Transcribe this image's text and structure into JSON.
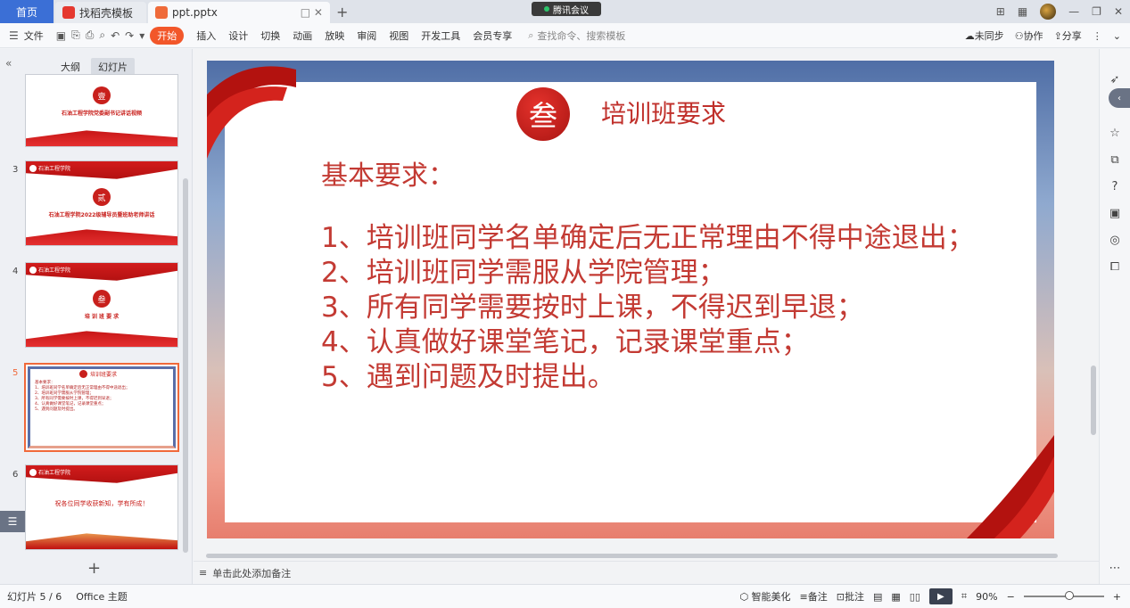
{
  "tabs": {
    "home": "首页",
    "items": [
      {
        "label": "找稻壳模板"
      },
      {
        "label": "ppt.pptx"
      }
    ],
    "add": "+",
    "meeting": "腾讯会议"
  },
  "menu": {
    "file": "文件",
    "items": [
      "开始",
      "插入",
      "设计",
      "切换",
      "动画",
      "放映",
      "审阅",
      "视图",
      "开发工具",
      "会员专享"
    ],
    "search_placeholder": "查找命令、搜索模板",
    "sync": "未同步",
    "collab": "协作",
    "share": "分享"
  },
  "left_panel": {
    "tabs": [
      "大纲",
      "幻灯片"
    ],
    "thumbs": [
      {
        "num": "",
        "badge": "壹",
        "caption": "石油工程学院党委副书记讲话视频"
      },
      {
        "num": "3",
        "badge": "贰",
        "caption": "石油工程学院2022级辅导员暨班助老师讲话"
      },
      {
        "num": "4",
        "badge": "叁",
        "caption": "培 训 班 要 求"
      },
      {
        "num": "5",
        "title": "培训班要求",
        "body": [
          "基本要求：",
          "1、培训班同学名单确定后无正常理由不得中途退出；",
          "2、培训班同学需服从学院管理；",
          "3、所有同学需要按时上课，不得迟到早退；",
          "4、认真做好课堂笔记，记录课堂重点；",
          "5、遇到问题及时提出。"
        ]
      },
      {
        "num": "6",
        "caption": "祝各位同学收获新知，学有所成！"
      }
    ],
    "school_name": "石油工程学院"
  },
  "slide": {
    "badge": "叁",
    "title": "培训班要求",
    "subtitle": "基本要求：",
    "items": [
      "1、培训班同学名单确定后无正常理由不得中途退出；",
      "2、培训班同学需服从学院管理；",
      "3、所有同学需要按时上课，不得迟到早退；",
      "4、认真做好课堂笔记，记录课堂重点；",
      "5、遇到问题及时提出。"
    ]
  },
  "notes": {
    "placeholder": "单击此处添加备注"
  },
  "status": {
    "slide_count": "幻灯片 5 / 6",
    "theme": "Office 主题",
    "beautify": "智能美化",
    "notes": "备注",
    "comments": "批注",
    "zoom": "90%"
  }
}
